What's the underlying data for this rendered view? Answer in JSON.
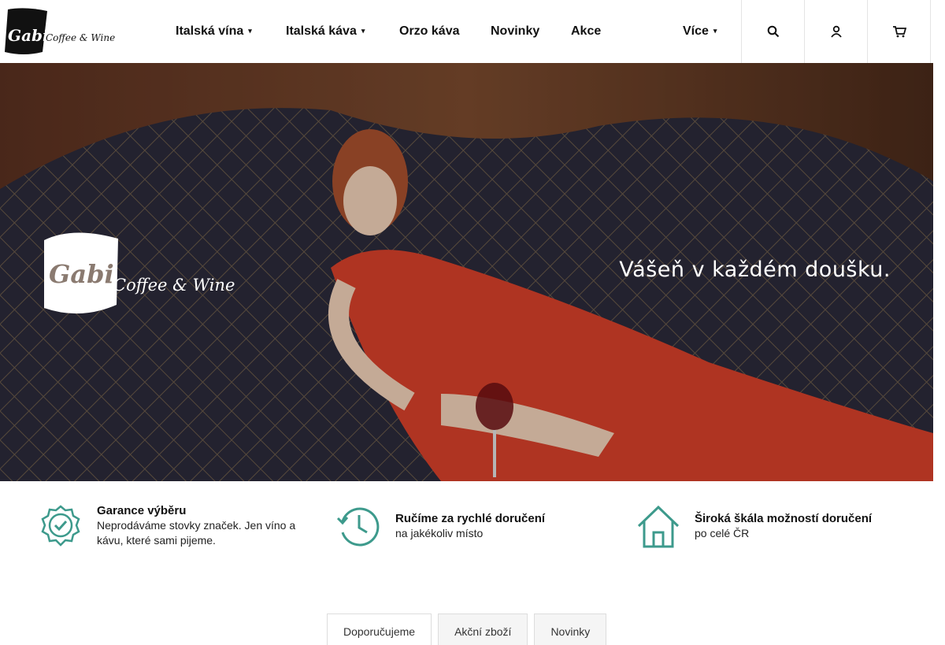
{
  "header": {
    "brand_main": "Gabi",
    "brand_sub": "Coffee & Wine",
    "nav": [
      {
        "label": "Italská vína",
        "has_dropdown": true
      },
      {
        "label": "Italská káva",
        "has_dropdown": true
      },
      {
        "label": "Orzo káva",
        "has_dropdown": false
      },
      {
        "label": "Novinky",
        "has_dropdown": false
      },
      {
        "label": "Akce",
        "has_dropdown": false
      }
    ],
    "more_label": "Více",
    "icons": [
      "search-icon",
      "user-icon",
      "cart-icon"
    ]
  },
  "hero": {
    "brand_main": "Gabi",
    "brand_sub": "Coffee & Wine",
    "tagline": "Vášeň v každém doušku."
  },
  "benefits": [
    {
      "icon": "badge-check-icon",
      "title": "Garance výběru",
      "desc": "Neprodáváme stovky značek. Jen víno a kávu, které sami pijeme."
    },
    {
      "icon": "clock-history-icon",
      "title": "Ručíme za rychlé doručení",
      "desc": "na jakékoliv místo"
    },
    {
      "icon": "home-icon",
      "title": "Široká škála možností doručení",
      "desc": "po celé ČR"
    }
  ],
  "tabs": [
    {
      "label": "Doporučujeme",
      "active": true
    },
    {
      "label": "Akční zboží",
      "active": false
    },
    {
      "label": "Novinky",
      "active": false
    }
  ],
  "colors": {
    "accent_icon": "#3d9a8c",
    "dress": "#d6402a"
  }
}
